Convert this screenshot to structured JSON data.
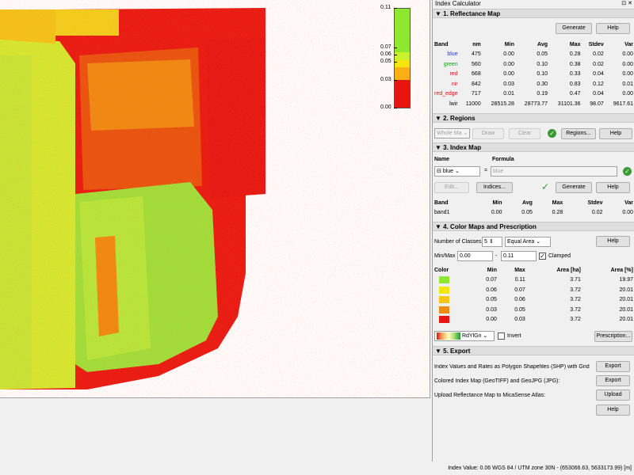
{
  "legend": {
    "ticks": [
      "0.11",
      "0.07",
      "0.06",
      "0.05",
      "0.03",
      "0.00"
    ],
    "colors": [
      "#8ee82f",
      "#c9f22b",
      "#f5e60e",
      "#fcb014",
      "#f07a10",
      "#e8140f"
    ]
  },
  "panel": {
    "title": "Index Calculator",
    "float_icon": "⊡",
    "close_icon": "✕",
    "sections": {
      "reflectance": "1. Reflectance Map",
      "regions": "2. Regions",
      "index": "3. Index Map",
      "colormaps": "4. Color Maps and Prescription",
      "export": "5. Export"
    }
  },
  "reflectance": {
    "generate_label": "Generate",
    "help_label": "Help",
    "headers": [
      "Band",
      "nm",
      "Min",
      "Avg",
      "Max",
      "Stdev",
      "Var"
    ],
    "rows": [
      {
        "band": "blue",
        "nm": "475",
        "min": "0.00",
        "avg": "0.05",
        "max": "0.28",
        "stdev": "0.02",
        "var": "0.00",
        "color": "#1f3bd6"
      },
      {
        "band": "green",
        "nm": "560",
        "min": "0.00",
        "avg": "0.10",
        "max": "0.38",
        "stdev": "0.02",
        "var": "0.00",
        "color": "#1e9b1e"
      },
      {
        "band": "red",
        "nm": "668",
        "min": "0.00",
        "avg": "0.10",
        "max": "0.33",
        "stdev": "0.04",
        "var": "0.00",
        "color": "#d41515"
      },
      {
        "band": "nir",
        "nm": "842",
        "min": "0.03",
        "avg": "0.30",
        "max": "0.83",
        "stdev": "0.12",
        "var": "0.01",
        "color": "#d41515"
      },
      {
        "band": "red_edge",
        "nm": "717",
        "min": "0.01",
        "avg": "0.19",
        "max": "0.47",
        "stdev": "0.04",
        "var": "0.00",
        "color": "#d41515"
      },
      {
        "band": "lwir",
        "nm": "11000",
        "min": "28515.28",
        "avg": "28773.77",
        "max": "31101.36",
        "stdev": "98.07",
        "var": "9617.61",
        "color": "#000000"
      }
    ]
  },
  "regions": {
    "select_value": "Whole Ma",
    "draw_label": "Draw",
    "clear_label": "Clear",
    "regions_label": "Regions...",
    "help_label": "Help"
  },
  "index": {
    "name_label": "Name",
    "formula_label": "Formula",
    "name_value": "blue",
    "equals": "=",
    "formula_value": "blue",
    "edit_label": "Edit...",
    "indices_label": "Indices...",
    "generate_label": "Generate",
    "help_label": "Help",
    "headers": [
      "Band",
      "Min",
      "Avg",
      "Max",
      "Stdev",
      "Var"
    ],
    "row": [
      "band1",
      "0.00",
      "0.05",
      "0.28",
      "0.02",
      "0.00"
    ]
  },
  "colormaps": {
    "classes_label": "Number of Classes",
    "classes_value": "5",
    "method_value": "Equal Area",
    "help_label": "Help",
    "minmax_label": "Min/Max",
    "min_value": "0.00",
    "dash": "-",
    "max_value": "0.11",
    "clamped_label": "Clamped",
    "headers": [
      "Color",
      "Min",
      "Max",
      "Area [ha]",
      "Area [%]"
    ],
    "rows": [
      {
        "color": "#8ee82f",
        "min": "0.07",
        "max": "0.11",
        "area": "3.71",
        "pct": "19.97"
      },
      {
        "color": "#f5e60e",
        "min": "0.06",
        "max": "0.07",
        "area": "3.72",
        "pct": "20.01"
      },
      {
        "color": "#fcc514",
        "min": "0.05",
        "max": "0.06",
        "area": "3.72",
        "pct": "20.01"
      },
      {
        "color": "#f08a10",
        "min": "0.03",
        "max": "0.05",
        "area": "3.72",
        "pct": "20.01"
      },
      {
        "color": "#e8140f",
        "min": "0.00",
        "max": "0.03",
        "area": "3.72",
        "pct": "20.01"
      }
    ],
    "ramp_name": "RdYlGn",
    "invert_label": "Invert",
    "prescription_label": "Prescription..."
  },
  "export": {
    "rows": [
      {
        "text": "Index Values and Rates as Polygon Shapefiles (SHP) with Grid Size",
        "button": "Export"
      },
      {
        "text": "Colored Index Map (GeoTIFF) and GeoJPG (JPG):",
        "button": "Export"
      },
      {
        "text": "Upload Reflectance Map to MicaSense Atlas:",
        "button": "Upload"
      }
    ],
    "help_label": "Help"
  },
  "status_text": "Index Value: 0.06  WGS 84 / UTM zone 30N - (653066.63, 5633173.99) [m]"
}
